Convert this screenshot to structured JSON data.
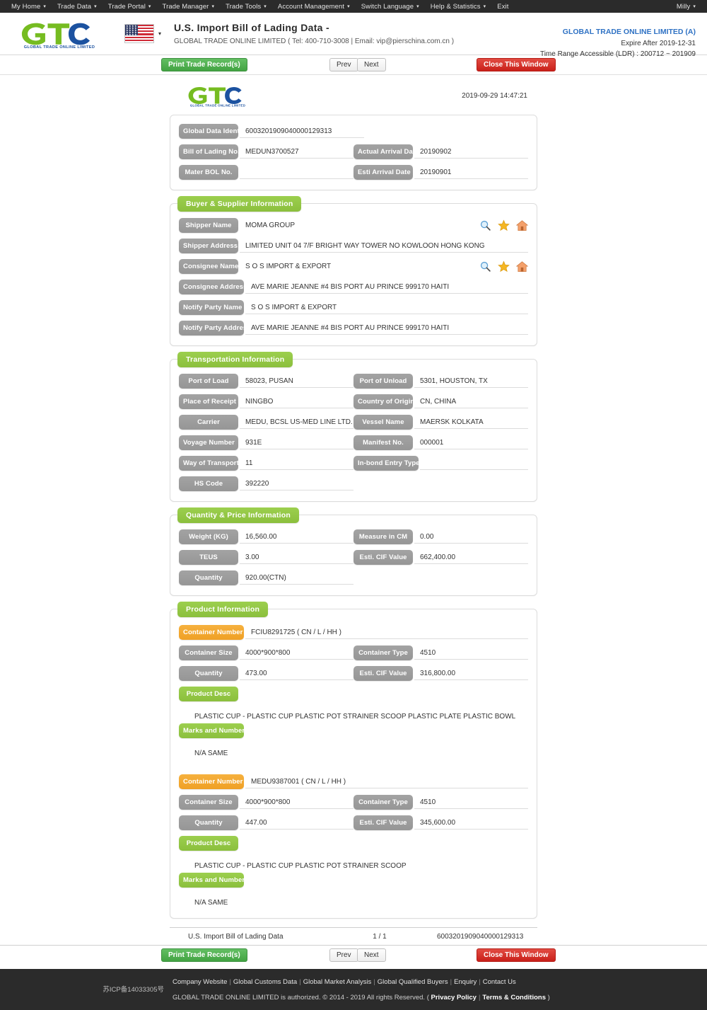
{
  "topnav": {
    "items": [
      {
        "label": "My Home",
        "caret": true
      },
      {
        "label": "Trade Data",
        "caret": true
      },
      {
        "label": "Trade Portal",
        "caret": true
      },
      {
        "label": "Trade Manager",
        "caret": true
      },
      {
        "label": "Trade Tools",
        "caret": true
      },
      {
        "label": "Account Management",
        "caret": true
      },
      {
        "label": "Switch Language",
        "caret": true
      },
      {
        "label": "Help & Statistics",
        "caret": true
      },
      {
        "label": "Exit",
        "caret": false
      }
    ],
    "user": "Milly"
  },
  "header": {
    "logo_text": "GLOBAL TRADE ONLINE LIMITED",
    "flag": "us-flag-icon",
    "title": "U.S. Import Bill of Lading Data  -",
    "subtitle": "GLOBAL TRADE ONLINE LIMITED ( Tel: 400-710-3008 | Email: vip@pierschina.com.cn )",
    "account": "GLOBAL TRADE ONLINE LIMITED (A)",
    "expire": "Expire After 2019-12-31",
    "time_range": "Time Range Accessible (LDR) : 200712 ~ 201909"
  },
  "toolbar": {
    "print_label": "Print Trade Record(s)",
    "prev_label": "Prev",
    "next_label": "Next",
    "close_label": "Close This Window"
  },
  "document": {
    "timestamp": "2019-09-29 14:47:21",
    "identity": {
      "global_data_identity_label": "Global Data Identity",
      "global_data_identity_value": "6003201909040000129313",
      "bill_of_lading_label": "Bill of Lading No.",
      "bill_of_lading_value": "MEDUN3700527",
      "actual_arrival_label": "Actual Arrival Date",
      "actual_arrival_value": "20190902",
      "master_bol_label": "Mater BOL No.",
      "master_bol_value": "",
      "esti_arrival_label": "Esti Arrival Date",
      "esti_arrival_value": "20190901"
    },
    "buyer_supplier": {
      "title": "Buyer & Supplier Information",
      "shipper_name_label": "Shipper Name",
      "shipper_name_value": "MOMA GROUP",
      "shipper_address_label": "Shipper Address",
      "shipper_address_value": "LIMITED UNIT 04 7/F BRIGHT WAY TOWER NO KOWLOON HONG KONG",
      "consignee_name_label": "Consignee Name",
      "consignee_name_value": "S O S IMPORT & EXPORT",
      "consignee_address_label": "Consignee Address",
      "consignee_address_value": "AVE MARIE JEANNE #4 BIS PORT AU PRINCE 999170 HAITI",
      "notify_party_name_label": "Notify Party Name",
      "notify_party_name_value": "S O S IMPORT & EXPORT",
      "notify_party_address_label": "Notify Party Address",
      "notify_party_address_value": "AVE MARIE JEANNE #4 BIS PORT AU PRINCE 999170 HAITI"
    },
    "transportation": {
      "title": "Transportation Information",
      "port_of_load_label": "Port of Load",
      "port_of_load_value": "58023, PUSAN",
      "port_of_unload_label": "Port of Unload",
      "port_of_unload_value": "5301, HOUSTON, TX",
      "place_of_receipt_label": "Place of Receipt",
      "place_of_receipt_value": "NINGBO",
      "country_of_origin_label": "Country of Origin",
      "country_of_origin_value": "CN, CHINA",
      "carrier_label": "Carrier",
      "carrier_value": "MEDU, BCSL US-MED LINE LTD.",
      "vessel_name_label": "Vessel Name",
      "vessel_name_value": "MAERSK KOLKATA",
      "voyage_number_label": "Voyage Number",
      "voyage_number_value": "931E",
      "manifest_no_label": "Manifest No.",
      "manifest_no_value": "000001",
      "way_of_transport_label": "Way of Transport",
      "way_of_transport_value": "11",
      "inbond_entry_type_label": "In-bond Entry Type",
      "inbond_entry_type_value": "",
      "hs_code_label": "HS Code",
      "hs_code_value": "392220"
    },
    "quantity_price": {
      "title": "Quantity & Price Information",
      "weight_label": "Weight (KG)",
      "weight_value": "16,560.00",
      "measure_label": "Measure in CM",
      "measure_value": "0.00",
      "teus_label": "TEUS",
      "teus_value": "3.00",
      "cif_label": "Esti. CIF Value",
      "cif_value": "662,400.00",
      "quantity_label": "Quantity",
      "quantity_value": "920.00(CTN)"
    },
    "product_information": {
      "title": "Product Information",
      "labels": {
        "container_number": "Container Number",
        "container_size": "Container Size",
        "container_type": "Container Type",
        "quantity": "Quantity",
        "cif": "Esti. CIF Value",
        "product_desc": "Product Desc",
        "marks_numbers": "Marks and Numbers"
      },
      "containers": [
        {
          "container_number": "FCIU8291725 ( CN / L / HH )",
          "container_size": "4000*900*800",
          "container_type": "4510",
          "quantity": "473.00",
          "cif": "316,800.00",
          "product_desc": "PLASTIC CUP - PLASTIC CUP PLASTIC POT STRAINER SCOOP PLASTIC PLATE PLASTIC BOWL",
          "marks_numbers": "N/A SAME"
        },
        {
          "container_number": "MEDU9387001 ( CN / L / HH )",
          "container_size": "4000*900*800",
          "container_type": "4510",
          "quantity": "447.00",
          "cif": "345,600.00",
          "product_desc": "PLASTIC CUP - PLASTIC CUP PLASTIC POT STRAINER SCOOP",
          "marks_numbers": "N/A SAME"
        }
      ]
    },
    "footer": {
      "left": "U.S. Import Bill of Lading Data",
      "page": "1 / 1",
      "right": "6003201909040000129313"
    }
  },
  "pagefooter": {
    "icp": "苏ICP备14033305号",
    "links": [
      "Company Website",
      "Global Customs Data",
      "Global Market Analysis",
      "Global Qualified Buyers",
      "Enquiry",
      "Contact Us"
    ],
    "copyright_prefix": "GLOBAL TRADE ONLINE LIMITED is authorized. © 2014 - 2019 All rights Reserved.  (",
    "privacy": "Privacy Policy",
    "terms": "Terms & Conditions",
    "copyright_suffix": ")"
  },
  "colors": {
    "nav_bg": "#2b2b2b",
    "green": "#8bbf3d",
    "orange": "#efa025",
    "grey_pill": "#969696",
    "red": "#c9201a",
    "blue_link": "#2f72c4"
  }
}
